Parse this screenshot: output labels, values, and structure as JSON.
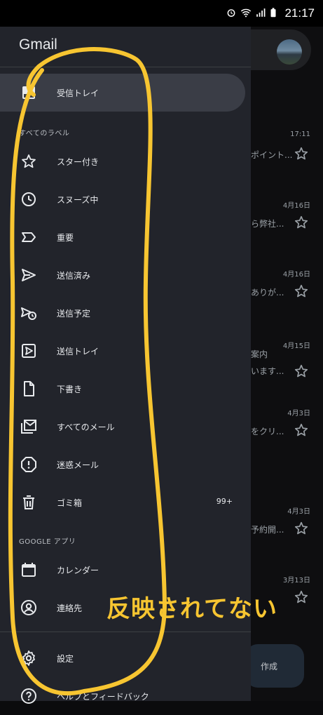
{
  "status_bar": {
    "time": "21:17"
  },
  "drawer": {
    "title": "Gmail",
    "inbox": {
      "label": "受信トレイ",
      "icon": "inbox-icon"
    },
    "section_all_labels": "すべてのラベル",
    "labels": [
      {
        "label": "スター付き",
        "icon": "star-icon"
      },
      {
        "label": "スヌーズ中",
        "icon": "clock-icon"
      },
      {
        "label": "重要",
        "icon": "important-icon"
      },
      {
        "label": "送信済み",
        "icon": "send-icon"
      },
      {
        "label": "送信予定",
        "icon": "scheduled-send-icon"
      },
      {
        "label": "送信トレイ",
        "icon": "outbox-icon"
      },
      {
        "label": "下書き",
        "icon": "draft-icon"
      },
      {
        "label": "すべてのメール",
        "icon": "all-mail-icon"
      },
      {
        "label": "迷惑メール",
        "icon": "spam-icon"
      },
      {
        "label": "ゴミ箱",
        "icon": "trash-icon",
        "count": "99+"
      }
    ],
    "section_google_apps": "GOOGLE アプリ",
    "apps": [
      {
        "label": "カレンダー",
        "icon": "calendar-icon"
      },
      {
        "label": "連絡先",
        "icon": "contacts-icon"
      }
    ],
    "settings": {
      "label": "設定",
      "icon": "gear-icon"
    },
    "help": {
      "label": "ヘルプとフィードバック",
      "icon": "help-icon"
    }
  },
  "inbox_background": {
    "rows": [
      {
        "date": "17:11",
        "snippet": "ポイント..."
      },
      {
        "date": "4月16日",
        "snippet": "ら弊社..."
      },
      {
        "date": "4月16日",
        "snippet": "ありが..."
      },
      {
        "date": "4月15日",
        "snippet": "案内",
        "snippet2": "います..."
      },
      {
        "date": "4月3日",
        "snippet": "をクリ..."
      },
      {
        "date": "4月3日",
        "snippet": "予約開..."
      },
      {
        "date": "3月13日",
        "snippet": ""
      }
    ],
    "compose_label": "作成"
  },
  "annotation": {
    "text": "反映されてない",
    "color": "#f7c531"
  },
  "colors": {
    "drawer_bg": "#22242b",
    "active_item": "#3a3d46",
    "annotation": "#f7c531"
  }
}
